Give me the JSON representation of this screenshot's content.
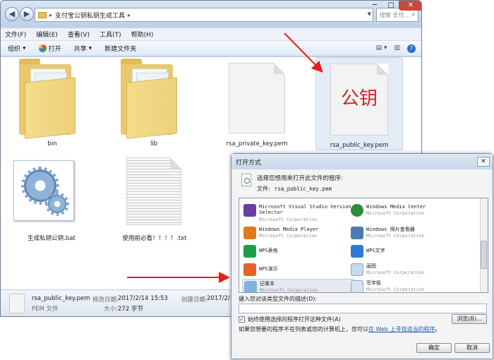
{
  "explorer": {
    "breadcrumb": "支付宝公钥私钥生成工具",
    "search_placeholder": "搜索 支付...",
    "menu": [
      "文件(F)",
      "编辑(E)",
      "查看(V)",
      "工具(T)",
      "帮助(H)"
    ],
    "toolbar": {
      "organize": "组织",
      "open": "打开",
      "share": "共享",
      "new_folder": "新建文件夹"
    },
    "items": [
      {
        "label": "bin",
        "kind": "folder"
      },
      {
        "label": "lib",
        "kind": "folder"
      },
      {
        "label": "rsa_private_key.pem",
        "kind": "file"
      },
      {
        "label": "rsa_public_key.pem",
        "kind": "file",
        "overlay_text": "公钥"
      },
      {
        "label": "生成私钥公钥.bat",
        "kind": "bat"
      },
      {
        "label": "使用前必看！！！！.txt",
        "kind": "txt"
      }
    ],
    "status": {
      "file_name": "rsa_public_key.pem",
      "modified_label": "修改日期:",
      "modified_value": "2017/2/14 15:53",
      "created_label": "创建日期:",
      "created_value": "2017/2/1",
      "type": "PEM 文件",
      "size_label": "大小:",
      "size_value": "272 字节"
    }
  },
  "dialog": {
    "title": "打开方式",
    "close": "✕",
    "prompt": "选择您想用来打开此文件的程序:",
    "file_label": "文件:",
    "file_value": "rsa_public_key.pem",
    "programs": [
      {
        "name": "Microsoft Visual Studio Version Selector",
        "company": "Microsoft Corporation",
        "icon_color": "#6b3fa0"
      },
      {
        "name": "Windows Media Center",
        "company": "Microsoft Corporation",
        "icon_color": "#2e8b3a"
      },
      {
        "name": "Windows Media Player",
        "company": "Microsoft Corporation",
        "icon_color": "#e07a1f"
      },
      {
        "name": "Windows 照片查看器",
        "company": "Microsoft Corporation",
        "icon_color": "#4a7bb5"
      },
      {
        "name": "WPS表格",
        "company": "",
        "icon_color": "#1f9e4a"
      },
      {
        "name": "WPS文字",
        "company": "",
        "icon_color": "#2f7ad8"
      },
      {
        "name": "WPS演示",
        "company": "",
        "icon_color": "#e4622a"
      },
      {
        "name": "画图",
        "company": "Microsoft Corporation",
        "icon_color": "#c8d8ee"
      },
      {
        "name": "记事本",
        "company": "Microsoft Corporation",
        "icon_color": "#7fb3e0"
      },
      {
        "name": "写字板",
        "company": "Microsoft Corporation",
        "icon_color": "#d8e4f2"
      }
    ],
    "desc_label": "键入您对该类型文件的描述(D):",
    "always_use": "始终使用选择的程序打开这种文件(A)",
    "always_checked": "✓",
    "browse": "浏览(B)...",
    "hint_prefix": "如果您想要的程序不在列表或您的计算机上，您可以",
    "hint_link": "在 Web 上寻找适当的程序",
    "hint_suffix": "。",
    "ok": "确定",
    "cancel": "取消"
  },
  "colors": {
    "arrow": "#e02020",
    "overlay_text": "#d42020",
    "link": "#1a5bbf"
  }
}
